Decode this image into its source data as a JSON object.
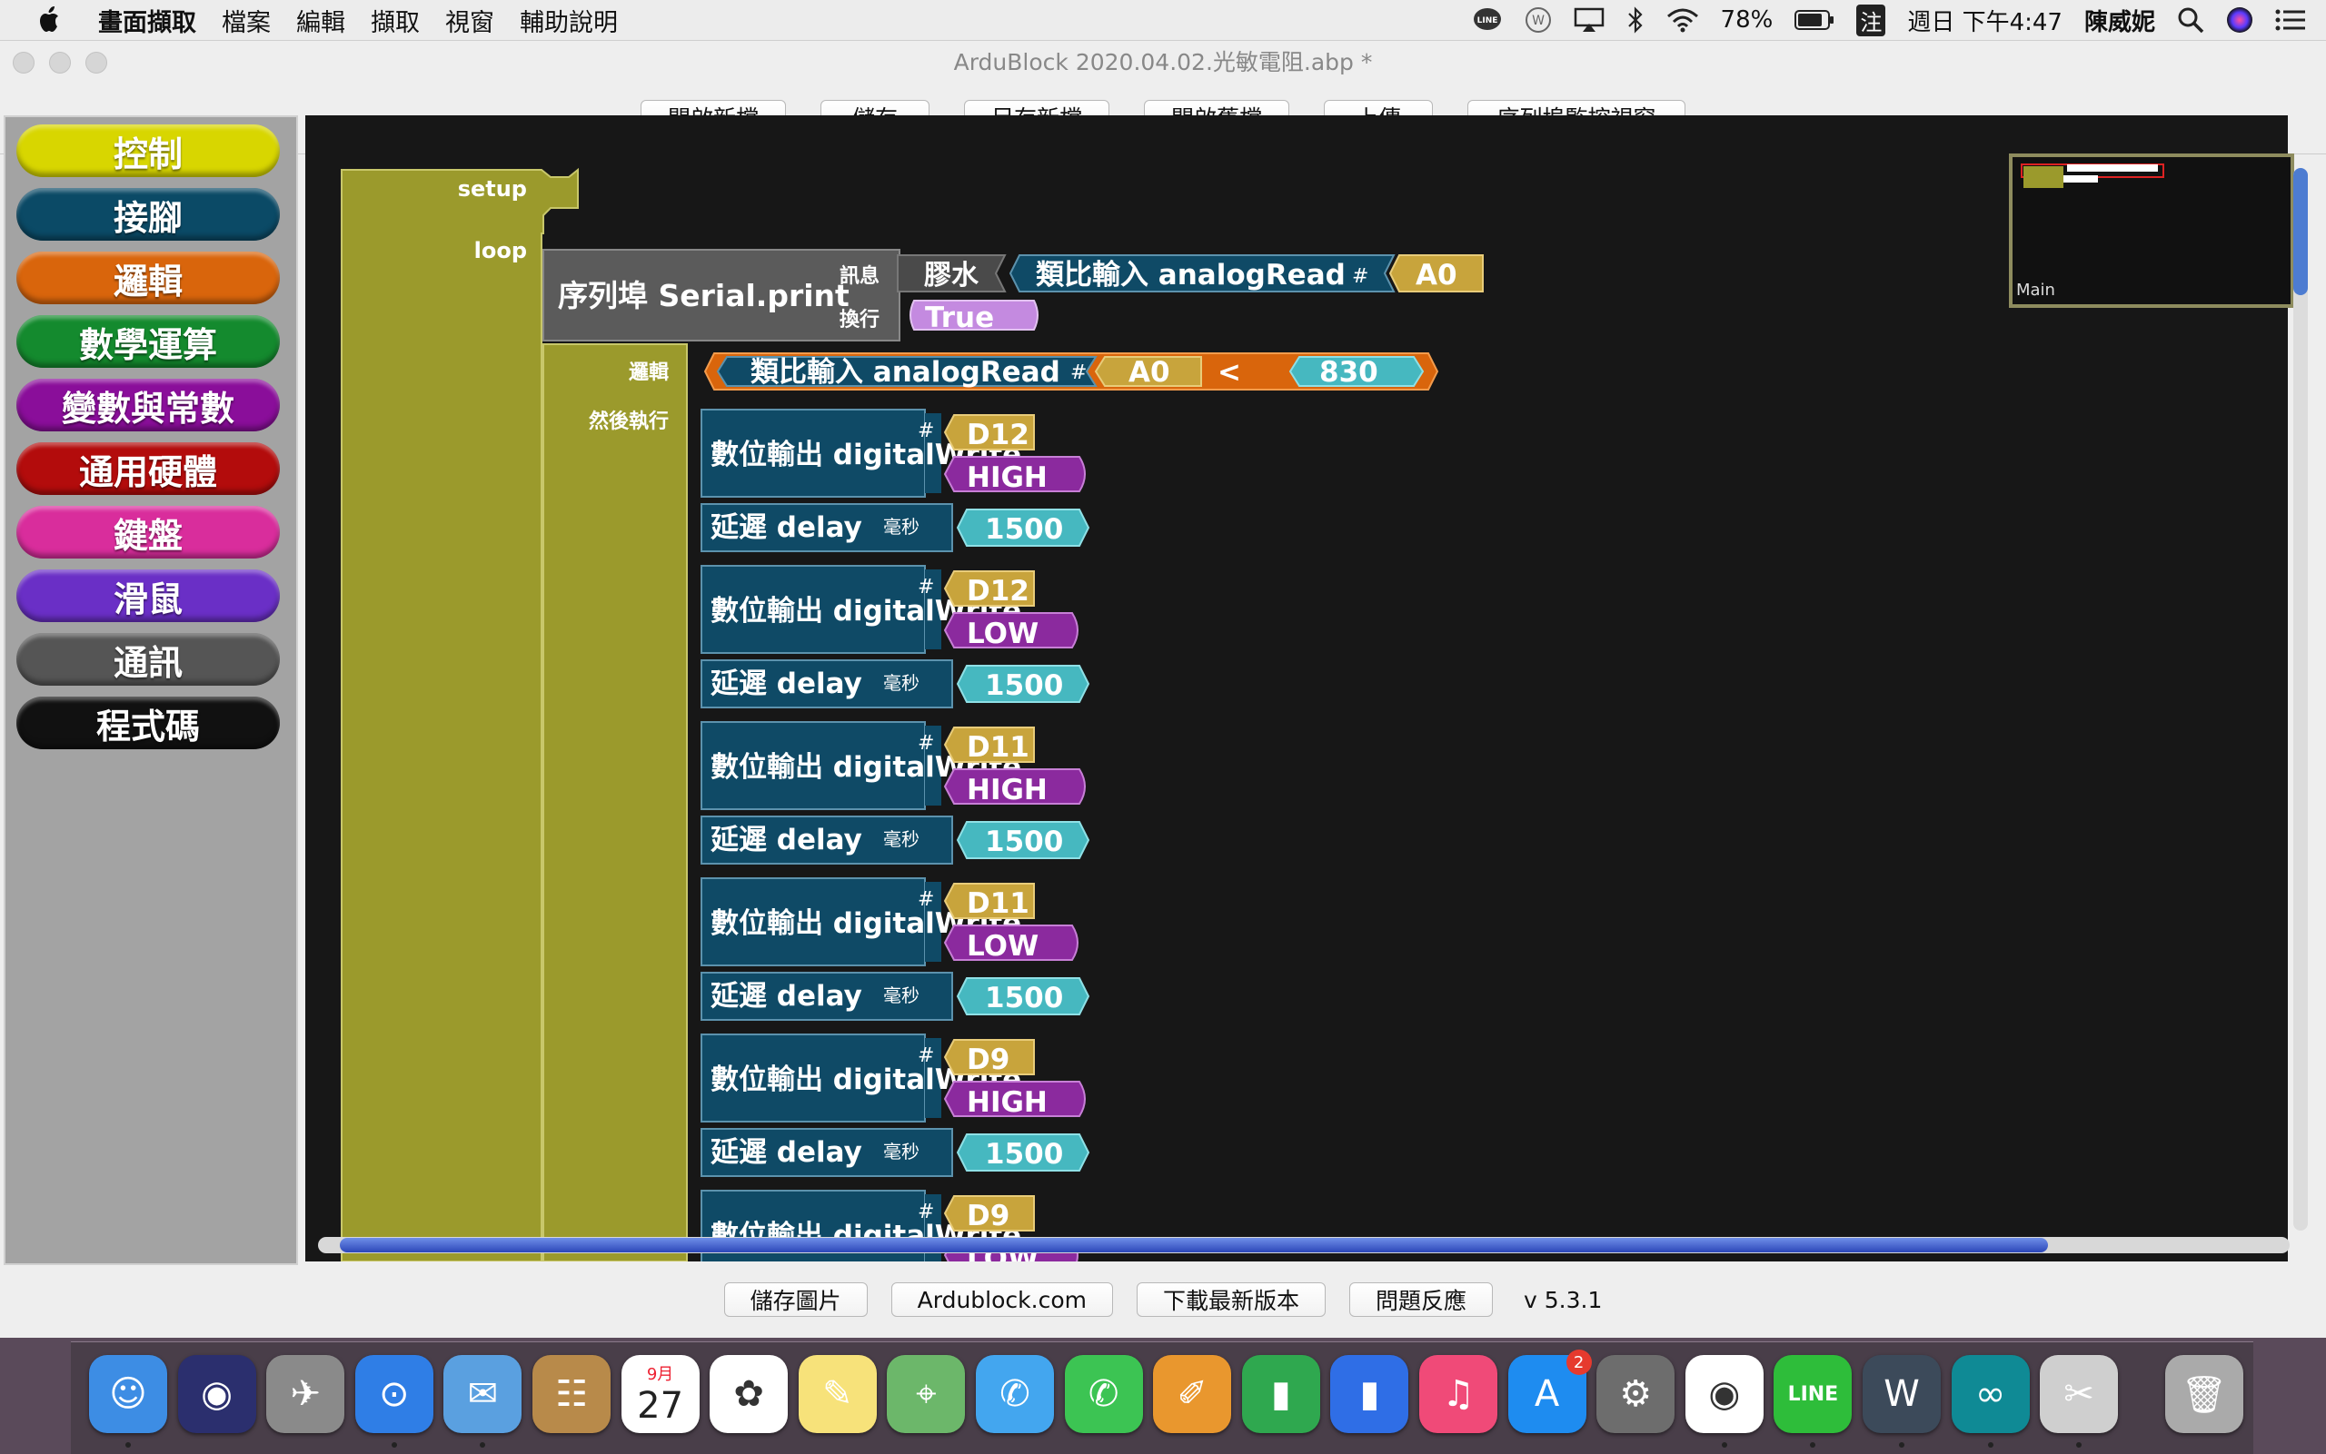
{
  "menubar": {
    "app": "畫面擷取",
    "items": [
      "檔案",
      "編輯",
      "擷取",
      "視窗",
      "輔助說明"
    ],
    "battery": "78%",
    "input_method": "注",
    "clock": "週日 下午4:47",
    "user": "陳威妮"
  },
  "window": {
    "title": "ArduBlock 2020.04.02.光敏電阻.abp *",
    "toolbar": [
      "開啟新檔",
      "儲存",
      "另存新檔",
      "開啟舊檔",
      "上傳",
      "序列埠監控視窗"
    ],
    "bottom": [
      "儲存圖片",
      "Ardublock.com",
      "下載最新版本",
      "問題反應"
    ],
    "version": "v 5.3.1"
  },
  "palette": {
    "categories": [
      {
        "label": "控制",
        "color": "#d8d600"
      },
      {
        "label": "接腳",
        "color": "#0b4a66"
      },
      {
        "label": "邏輯",
        "color": "#d9650c"
      },
      {
        "label": "數學運算",
        "color": "#148a2e"
      },
      {
        "label": "變數與常數",
        "color": "#8a0e9a"
      },
      {
        "label": "通用硬體",
        "color": "#b30c0c"
      },
      {
        "label": "鍵盤",
        "color": "#d92d9c"
      },
      {
        "label": "滑鼠",
        "color": "#6a2fc6"
      },
      {
        "label": "通訊",
        "color": "#555555"
      },
      {
        "label": "程式碼",
        "color": "#111111"
      }
    ]
  },
  "program": {
    "main_block": {
      "setup_label": "setup",
      "loop_label": "loop",
      "color": "#9b9a2c"
    },
    "serial_print": {
      "label": "序列埠 Serial.print",
      "message_label": "訊息",
      "newline_label": "換行",
      "glue_label": "膠水",
      "read_label": "類比輸入 analogRead",
      "hash": "#",
      "pin": "A0",
      "newline_value": "True"
    },
    "if_block": {
      "logic_label": "邏輯",
      "then_label": "然後執行",
      "read_label": "類比輸入 analogRead",
      "hash": "#",
      "pin": "A0",
      "operator": "<",
      "threshold": "830"
    },
    "statements": [
      {
        "type": "digitalWrite",
        "label": "數位輸出 digitalWrite",
        "hash": "#",
        "pin": "D12",
        "value": "HIGH"
      },
      {
        "type": "delay",
        "label": "延遲 delay",
        "unit": "毫秒",
        "value": "1500"
      },
      {
        "type": "digitalWrite",
        "label": "數位輸出 digitalWrite",
        "hash": "#",
        "pin": "D12",
        "value": "LOW"
      },
      {
        "type": "delay",
        "label": "延遲 delay",
        "unit": "毫秒",
        "value": "1500"
      },
      {
        "type": "digitalWrite",
        "label": "數位輸出 digitalWrite",
        "hash": "#",
        "pin": "D11",
        "value": "HIGH"
      },
      {
        "type": "delay",
        "label": "延遲 delay",
        "unit": "毫秒",
        "value": "1500"
      },
      {
        "type": "digitalWrite",
        "label": "數位輸出 digitalWrite",
        "hash": "#",
        "pin": "D11",
        "value": "LOW"
      },
      {
        "type": "delay",
        "label": "延遲 delay",
        "unit": "毫秒",
        "value": "1500"
      },
      {
        "type": "digitalWrite",
        "label": "數位輸出 digitalWrite",
        "hash": "#",
        "pin": "D9",
        "value": "HIGH"
      },
      {
        "type": "delay",
        "label": "延遲 delay",
        "unit": "毫秒",
        "value": "1500"
      },
      {
        "type": "digitalWrite",
        "label": "數位輸出 digitalWrite",
        "hash": "#",
        "pin": "D9",
        "value": "LOW"
      }
    ],
    "colors": {
      "command": "#0f4a66",
      "pin": "#c8a43c",
      "high_low": "#8b2a9e",
      "number": "#46b8c0",
      "logic": "#d9650c",
      "serial": "#5b5b5b",
      "glue": "#4a4a4a",
      "true_val": "#c48ae0"
    }
  },
  "minimap": {
    "label": "Main"
  },
  "dock": {
    "apps": [
      "Finder",
      "Siri",
      "Launchpad",
      "Safari",
      "Mail",
      "Contacts",
      "Calendar",
      "Photos",
      "Notes",
      "Maps",
      "Messages",
      "FaceTime",
      "Pages",
      "Numbers",
      "Keynote",
      "iTunes",
      "App Store",
      "System Preferences",
      "Chrome",
      "LINE",
      "Wondershare",
      "Arduino",
      "Screenshot",
      "Trash"
    ],
    "calendar_month": "9月",
    "calendar_day": "27",
    "appstore_badge": "2"
  }
}
